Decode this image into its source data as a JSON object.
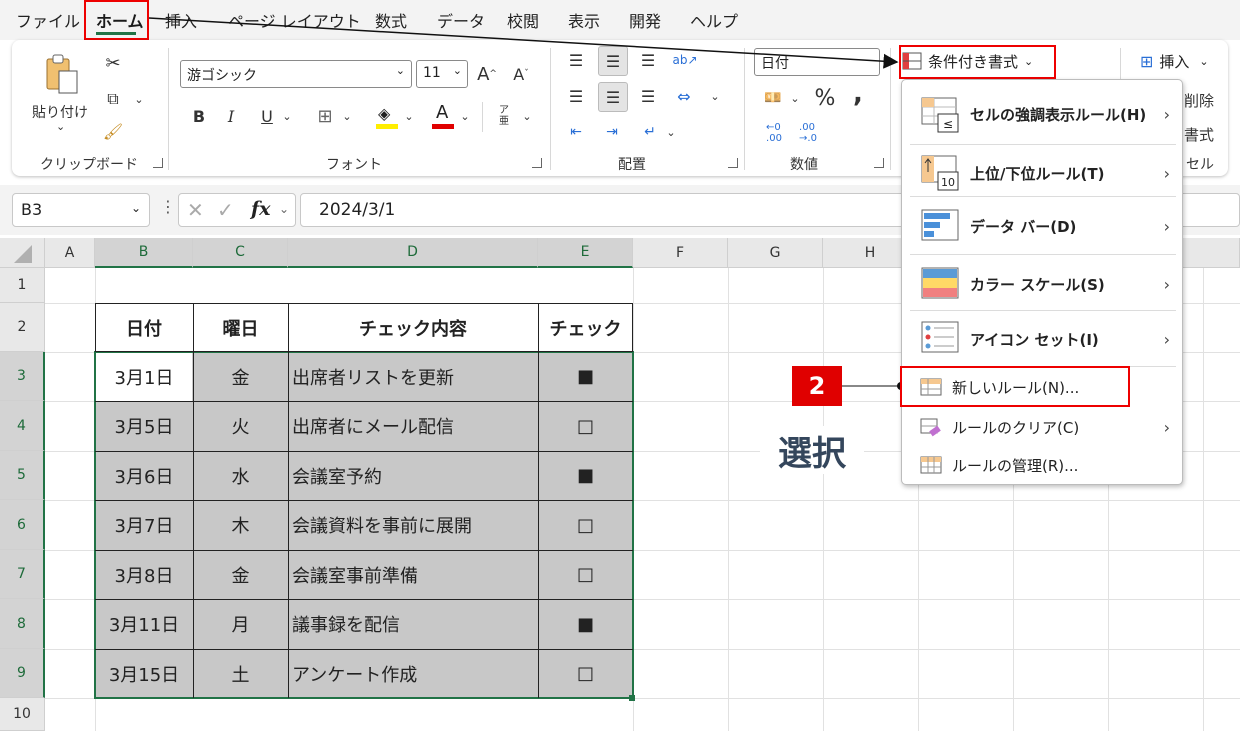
{
  "tabs": [
    "ファイル",
    "ホーム",
    "挿入",
    "ページ レイアウト",
    "数式",
    "データ",
    "校閲",
    "表示",
    "開発",
    "ヘルプ"
  ],
  "clipboard": {
    "paste_label": "貼り付け",
    "group_label": "クリップボード"
  },
  "font": {
    "name": "游ゴシック",
    "size": "11",
    "group_label": "フォント",
    "bold": "B",
    "italic": "I",
    "underline": "U",
    "grow": "A^",
    "shrink": "Aˇ"
  },
  "alignment": {
    "group_label": "配置"
  },
  "number": {
    "format": "日付",
    "percent": "%",
    "comma": ",",
    "group_label": "数値"
  },
  "styles": {
    "cond_format_label": "条件付き書式"
  },
  "cells": {
    "insert_label": "挿入",
    "delete_partial": "削除",
    "format_partial": "書式",
    "group_partial": "セル"
  },
  "formula_bar": {
    "name_box": "B3",
    "fx": "fx",
    "value": "2024/3/1"
  },
  "columns": [
    "A",
    "B",
    "C",
    "D",
    "E",
    "F",
    "G",
    "H"
  ],
  "rows": [
    "1",
    "2",
    "3",
    "4",
    "5",
    "6",
    "7",
    "8",
    "9",
    "10"
  ],
  "table": {
    "headers": [
      "日付",
      "曜日",
      "チェック内容",
      "チェック"
    ],
    "rows": [
      [
        "3月1日",
        "金",
        "出席者リストを更新",
        "■"
      ],
      [
        "3月5日",
        "火",
        "出席者にメール配信",
        "□"
      ],
      [
        "3月6日",
        "水",
        "会議室予約",
        "■"
      ],
      [
        "3月7日",
        "木",
        "会議資料を事前に展開",
        "□"
      ],
      [
        "3月8日",
        "金",
        "会議室事前準備",
        "□"
      ],
      [
        "3月11日",
        "月",
        "議事録を配信",
        "■"
      ],
      [
        "3月15日",
        "土",
        "アンケート作成",
        "□"
      ]
    ]
  },
  "menu": {
    "items": [
      {
        "label": "セルの強調表示ルール(H)",
        "icon": "highlight-rules-icon"
      },
      {
        "label": "上位/下位ルール(T)",
        "icon": "top-bottom-icon"
      },
      {
        "label": "データ バー(D)",
        "icon": "data-bar-icon"
      },
      {
        "label": "カラー スケール(S)",
        "icon": "color-scale-icon"
      },
      {
        "label": "アイコン セット(I)",
        "icon": "icon-set-icon"
      },
      {
        "label": "新しいルール(N)...",
        "icon": "new-rule-icon"
      },
      {
        "label": "ルールのクリア(C)",
        "icon": "clear-rules-icon"
      },
      {
        "label": "ルールの管理(R)...",
        "icon": "manage-rules-icon"
      }
    ]
  },
  "annotation": {
    "step": "2",
    "select_label": "選択"
  },
  "colors": {
    "accent_red": "#e00000",
    "excel_green": "#217346",
    "selection_gray": "#c8c8c8"
  }
}
